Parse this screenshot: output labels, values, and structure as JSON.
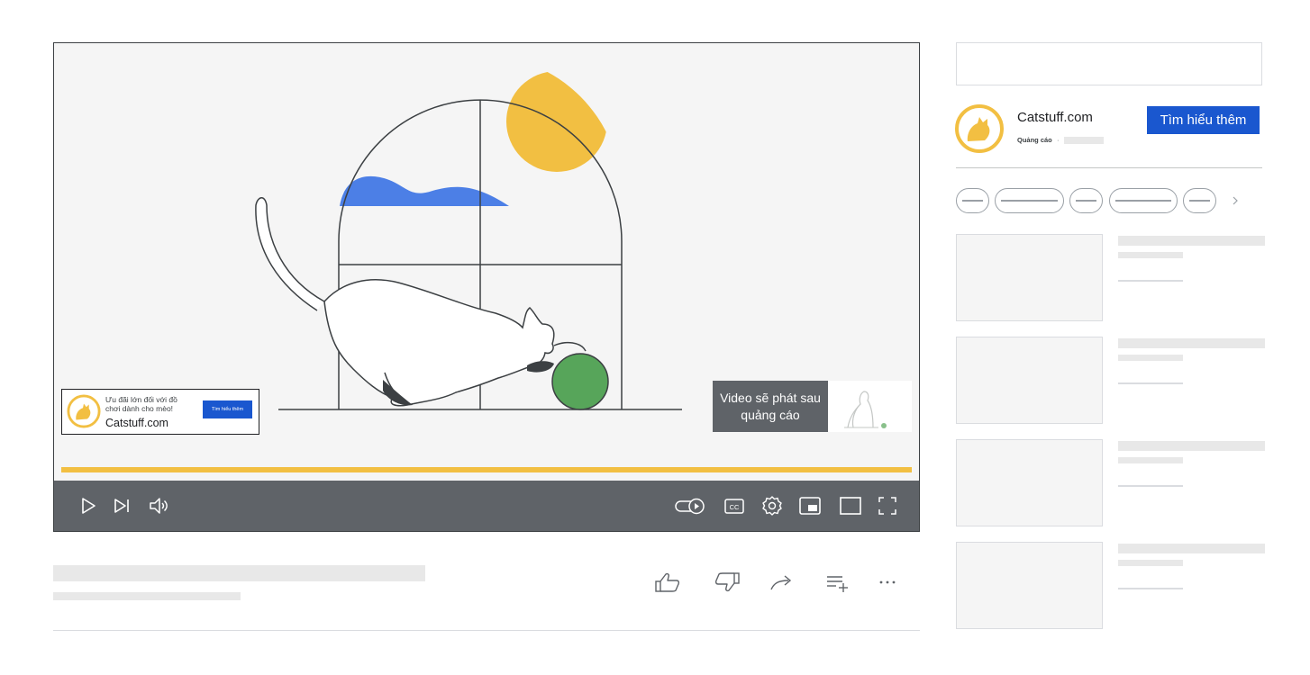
{
  "player": {
    "overlay_ad": {
      "line1": "Ưu đãi lớn đối với đồ",
      "line2": "chơi dành cho mèo!",
      "brand": "Catstuff.com",
      "cta_label": "Tìm hiểu thêm"
    },
    "after_ad_text": "Video sẽ phát sau quảng cáo",
    "progress_fraction": 1.0,
    "progress_color": "#f2bf42",
    "controls": {
      "left": [
        "play-icon",
        "next-icon",
        "volume-icon"
      ],
      "right": [
        "autoplay-toggle-icon",
        "captions-icon",
        "settings-icon",
        "miniplayer-icon",
        "theater-mode-icon",
        "fullscreen-icon"
      ],
      "captions_label": "CC"
    }
  },
  "actions": [
    "like-icon",
    "dislike-icon",
    "share-icon",
    "save-to-playlist-icon",
    "more-icon"
  ],
  "sidebar": {
    "ad": {
      "brand": "Catstuff.com",
      "label": "Quảng cáo",
      "separator": "·",
      "cta_label": "Tìm hiểu thêm"
    },
    "chips_count": 5,
    "related_count": 4
  },
  "colors": {
    "brand_blue": "#1a57cf",
    "control_bar": "#5f6368",
    "sun_yellow": "#f2bf42",
    "cloud_blue": "#4c7fe6",
    "ball_green": "#57a55a"
  }
}
